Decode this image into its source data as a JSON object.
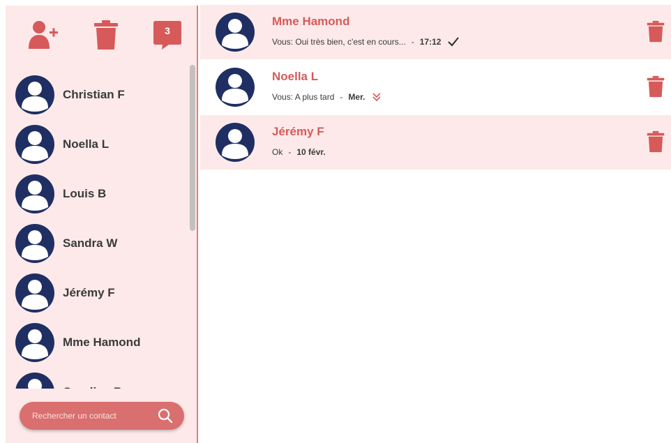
{
  "colors": {
    "accent": "#d65a5a",
    "avatar": "#1f2f63",
    "panel": "#fde9e9"
  },
  "toolbar": {
    "add_contact_icon": "add-user-icon",
    "delete_icon": "trash-icon",
    "messages_badge_count": "3"
  },
  "contacts": [
    {
      "name": "Christian F"
    },
    {
      "name": "Noella L"
    },
    {
      "name": "Louis B"
    },
    {
      "name": "Sandra W"
    },
    {
      "name": "Jérémy F"
    },
    {
      "name": "Mme Hamond"
    },
    {
      "name": "Caroline B"
    }
  ],
  "search": {
    "placeholder": "Rechercher un contact"
  },
  "conversations": [
    {
      "name": "Mme Hamond",
      "preview": "Vous: Oui très bien, c'est en cours...",
      "separator": "-",
      "time": "17:12",
      "status": "sent-check-icon"
    },
    {
      "name": "Noella L",
      "preview": "Vous: A plus tard",
      "separator": "-",
      "time": "Mer.",
      "status": "read-double-check-icon"
    },
    {
      "name": "Jérémy F",
      "preview": "Ok",
      "separator": "-",
      "time": "10 févr.",
      "status": ""
    }
  ]
}
